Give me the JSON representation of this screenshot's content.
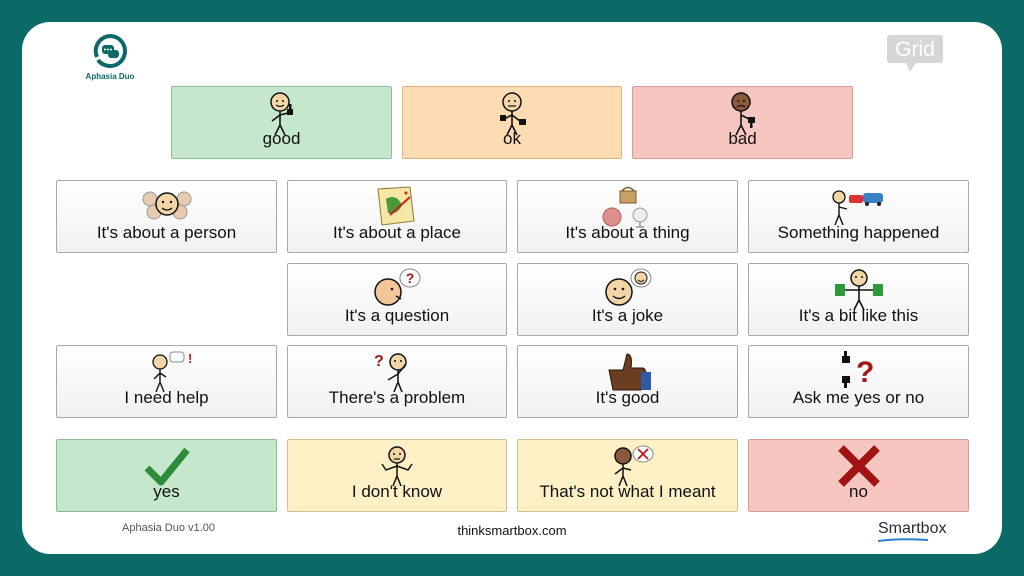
{
  "app": {
    "logo_text": "Aphasia Duo",
    "grid_logo_text": "Grid",
    "version": "Aphasia Duo v1.00",
    "website": "thinksmartbox.com",
    "brand": "Smartbox"
  },
  "top_row": [
    {
      "label": "good",
      "icon": "person-thumbs-up-icon"
    },
    {
      "label": "ok",
      "icon": "person-thumb-sideways-icon"
    },
    {
      "label": "bad",
      "icon": "person-thumbs-down-icon"
    }
  ],
  "grid": {
    "row1": [
      {
        "label": "It's about a person",
        "icon": "people-crowd-icon"
      },
      {
        "label": "It's about a place",
        "icon": "map-icon"
      },
      {
        "label": "It's about a thing",
        "icon": "objects-icon"
      },
      {
        "label": "Something happened",
        "icon": "car-crash-icon"
      }
    ],
    "row2": [
      {
        "label": "It's a question",
        "icon": "question-face-icon"
      },
      {
        "label": "It's a joke",
        "icon": "joke-face-icon"
      },
      {
        "label": "It's a bit like this",
        "icon": "person-comparing-icon"
      }
    ],
    "row3": [
      {
        "label": "I need help",
        "icon": "help-person-icon"
      },
      {
        "label": "There's a problem",
        "icon": "confused-person-icon"
      },
      {
        "label": "It's good",
        "icon": "thumbs-up-hand-icon"
      },
      {
        "label": "Ask me yes or no",
        "icon": "thumbs-question-icon"
      }
    ]
  },
  "bottom_row": [
    {
      "label": "yes",
      "icon": "checkmark-icon"
    },
    {
      "label": "I don't know",
      "icon": "shrug-person-icon"
    },
    {
      "label": "That's not what I meant",
      "icon": "wrong-meaning-icon"
    },
    {
      "label": "no",
      "icon": "cross-icon"
    }
  ],
  "colors": {
    "background": "#0b6a67",
    "green": "#c5e8cc",
    "orange": "#fddcb4",
    "pink": "#f7c6c1",
    "yellow": "#fdf0c5",
    "check": "#2e8b3a",
    "cross": "#a11212"
  }
}
